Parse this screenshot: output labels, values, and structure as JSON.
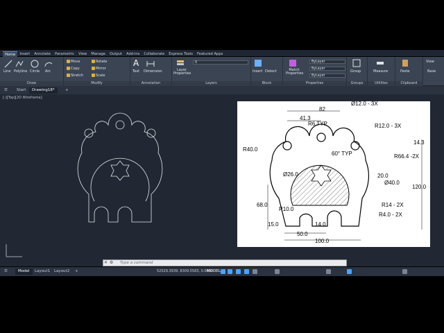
{
  "ribbon_tabs": [
    "Home",
    "Insert",
    "Annotate",
    "Parametric",
    "View",
    "Manage",
    "Output",
    "Add-ins",
    "Collaborate",
    "Express Tools",
    "Featured Apps"
  ],
  "draw_panel": {
    "title": "Draw",
    "tools": [
      "Line",
      "Polyline",
      "Circle",
      "Arc"
    ]
  },
  "modify_panel": {
    "title": "Modify",
    "tools": [
      "Move",
      "Rotate",
      "Copy",
      "Mirror",
      "Stretch",
      "Scale"
    ]
  },
  "annotation_panel": {
    "title": "Annotation",
    "tools": [
      "Text",
      "Dimension"
    ]
  },
  "layers_panel": {
    "title": "Layers",
    "tools": [
      "Layer Properties"
    ],
    "layer_value": "0"
  },
  "block_panel": {
    "title": "Block",
    "tools": [
      "Insert",
      "Detect"
    ]
  },
  "properties_panel": {
    "title": "Properties",
    "tools": [
      "Match Properties"
    ],
    "fields": [
      "ByLayer",
      "ByLayer",
      "ByLayer"
    ]
  },
  "groups_panel": {
    "title": "Groups",
    "tools": [
      "Group"
    ]
  },
  "utilities_panel": {
    "title": "Utilities",
    "tools": [
      "Measure"
    ]
  },
  "clipboard_panel": {
    "title": "Clipboard",
    "tools": [
      "Paste"
    ]
  },
  "view_panel": {
    "tools": [
      "View"
    ]
  },
  "base_panel": {
    "tools": [
      "Base"
    ]
  },
  "doc_tabs": {
    "start": "Start",
    "drawing": "Drawing18*"
  },
  "viewport_label": "[-][Top][2D Wireframe]",
  "command": {
    "placeholder": "Type a command"
  },
  "layout_tabs": [
    "Model",
    "Layout1",
    "Layout2"
  ],
  "status": {
    "coords": "52529.3939, 8309.5583, 0.0000",
    "model": "MODEL"
  },
  "drawing_dims": {
    "d1": "Ø12.0 - 3X",
    "d2": "82",
    "d3": "41.3",
    "d4": "R6 TYP",
    "d5": "R12.0 - 3X",
    "d6": "R40.0",
    "d7": "60° TYP",
    "d8": "R66.4 -2X",
    "d9": "14.3",
    "d10": "Ø26.0",
    "d11": "20.0",
    "d12": "Ø40.0",
    "d13": "120.0",
    "d14": "68.0",
    "d15": "R10.0",
    "d16": "R14 - 2X",
    "d17": "R4.0 - 2X",
    "d18": "15.0",
    "d19": "14.0",
    "d20": "50.0",
    "d21": "100.0"
  },
  "colors": {
    "accent": "#4aa3ff",
    "canvas": "#212833",
    "ribbon": "#3b4453"
  }
}
